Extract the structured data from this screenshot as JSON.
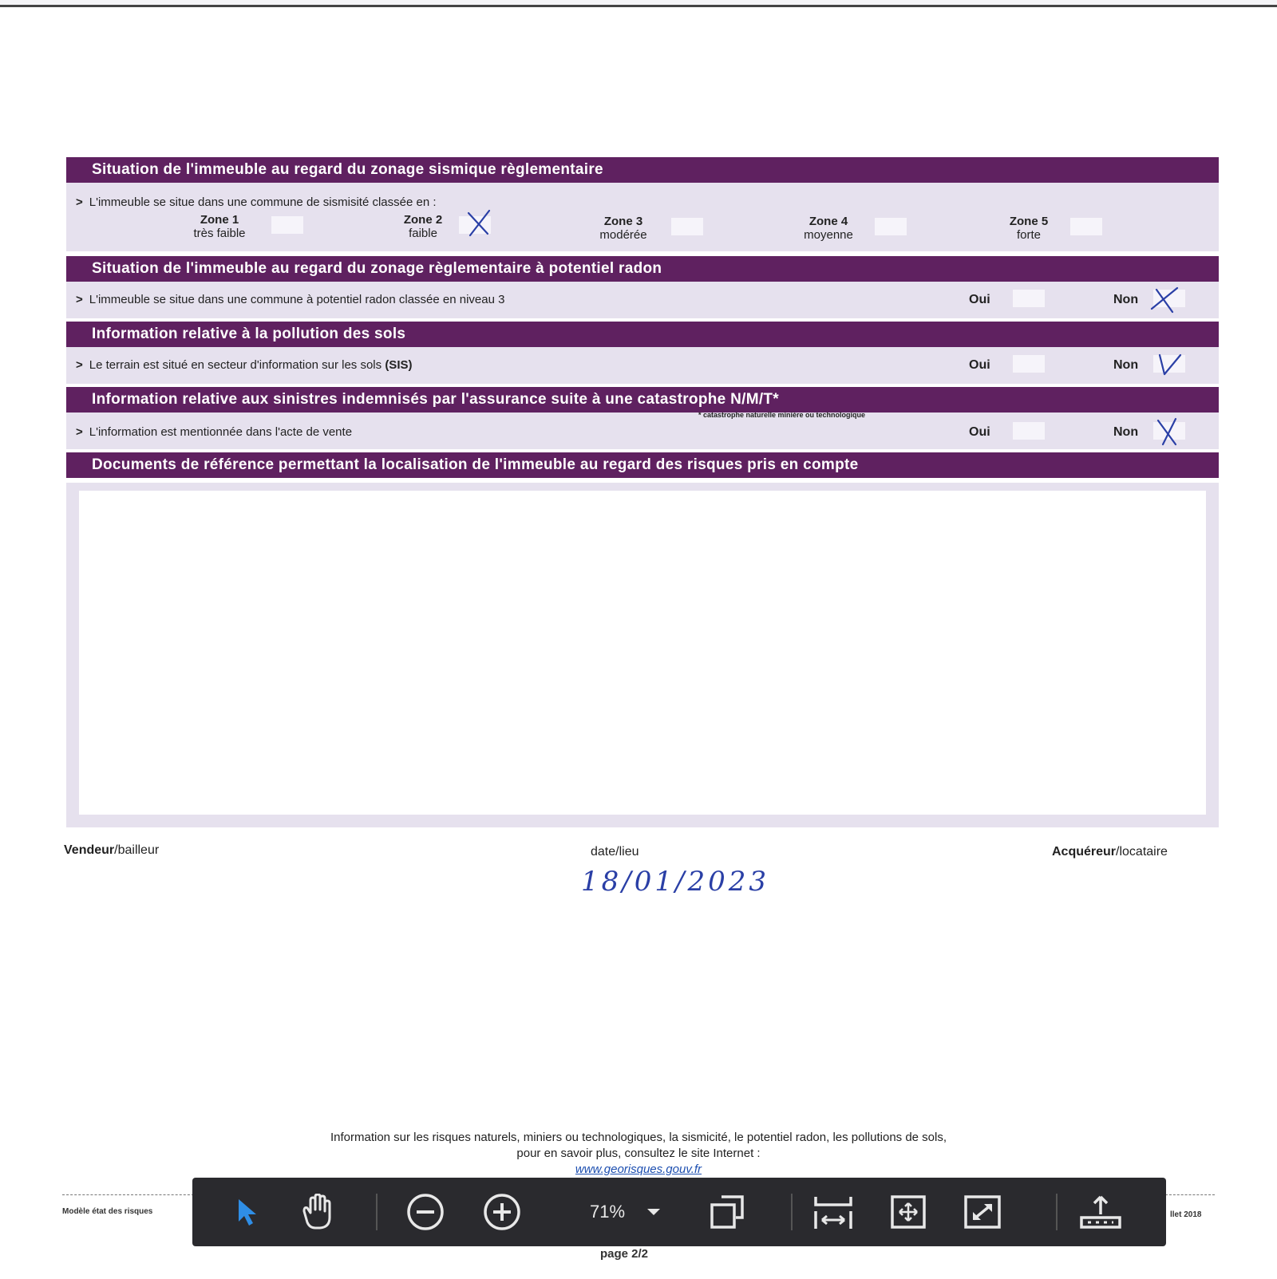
{
  "sections": {
    "sismique": {
      "title": "Situation de l'immeuble au regard du zonage sismique règlementaire",
      "text": "L'immeuble se situe dans une commune de sismisité classée en :",
      "zones": [
        {
          "name": "Zone 1",
          "level": "très faible",
          "checked": false
        },
        {
          "name": "Zone 2",
          "level": "faible",
          "checked": true
        },
        {
          "name": "Zone 3",
          "level": "modérée",
          "checked": false
        },
        {
          "name": "Zone 4",
          "level": "moyenne",
          "checked": false
        },
        {
          "name": "Zone 5",
          "level": "forte",
          "checked": false
        }
      ]
    },
    "radon": {
      "title": "Situation de l'immeuble au regard du zonage règlementaire à potentiel radon",
      "text": "L'immeuble se situe dans une commune à potentiel radon classée en niveau 3",
      "oui_label": "Oui",
      "non_label": "Non",
      "answer": "non"
    },
    "pollution": {
      "title": "Information relative à la pollution des sols",
      "text_prefix": "Le terrain est situé en secteur d'information sur les sols ",
      "text_bold": "(SIS)",
      "oui_label": "Oui",
      "non_label": "Non",
      "answer": "non"
    },
    "sinistres": {
      "title": "Information relative aux sinistres indemnisés par l'assurance suite à une catastrophe N/M/T*",
      "footnote": "* catastrophe naturelle minière ou technologique",
      "text": "L'information est mentionnée dans l'acte de vente",
      "oui_label": "Oui",
      "non_label": "Non",
      "answer": "non"
    },
    "documents": {
      "title": "Documents de référence permettant la localisation de l'immeuble au regard des risques pris en compte"
    }
  },
  "signature": {
    "vendeur_bold": "Vendeur",
    "vendeur_rest": "/bailleur",
    "date_label": "date/lieu",
    "date_value": "18/01/2023",
    "acquereur_bold": "Acquéreur",
    "acquereur_rest": "/locataire"
  },
  "footer": {
    "info_line1": "Information sur les risques naturels, miniers ou technologiques, la sismicité, le potentiel radon, les pollutions de sols,",
    "info_line2": "pour en savoir plus, consultez le site Internet :",
    "link": "www.georisques.gouv.fr",
    "model_text": "Modèle état des risques",
    "date_text": "llet 2018",
    "page": "page 2/2"
  },
  "toolbar": {
    "zoom": "71%",
    "icons": [
      "select-arrow-icon",
      "hand-pan-icon",
      "zoom-out-icon",
      "zoom-in-icon",
      "chevron-down-icon",
      "copy-pages-icon",
      "fit-width-icon",
      "fit-page-icon",
      "fullscreen-icon",
      "upload-icon"
    ]
  },
  "colors": {
    "band": "#5f2160",
    "light_row": "#e6e1ee",
    "ink": "#2a3fa6",
    "toolbar": "#2a2a2e",
    "select_icon": "#2f8ee6"
  }
}
